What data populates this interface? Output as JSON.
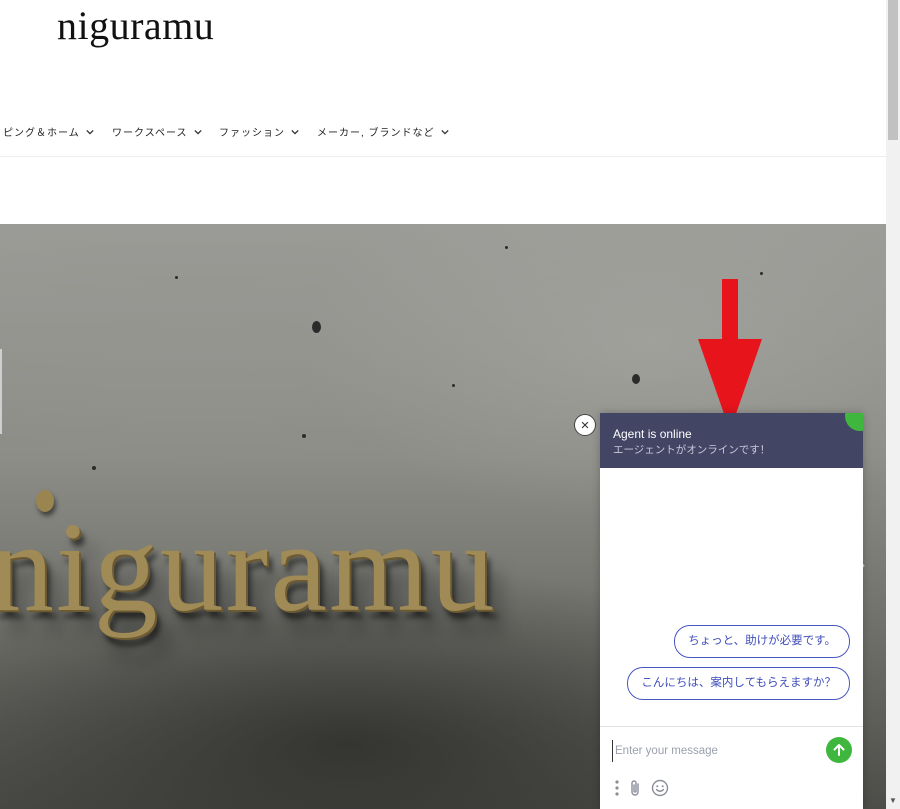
{
  "site": {
    "title": "niguramu"
  },
  "nav": {
    "items": [
      {
        "label": "ピング＆ホーム"
      },
      {
        "label": "ワークスペース"
      },
      {
        "label": "ファッション"
      },
      {
        "label": "メーカー, ブランドなど"
      }
    ]
  },
  "hero": {
    "sign_text": "niguramu"
  },
  "chat": {
    "title": "Agent is online",
    "subtitle": "エージェントがオンラインです！",
    "quick_replies": [
      {
        "label": "ちょっと、助けが必要です。"
      },
      {
        "label": "こんにちは、案内してもらえますか？"
      }
    ],
    "input_placeholder": "Enter your message",
    "close_icon": "×"
  },
  "colors": {
    "chat_header": "#434565",
    "accent_green": "#3fb73f",
    "quick_reply_border": "#4856c2",
    "annotation_arrow": "#e8141b"
  }
}
